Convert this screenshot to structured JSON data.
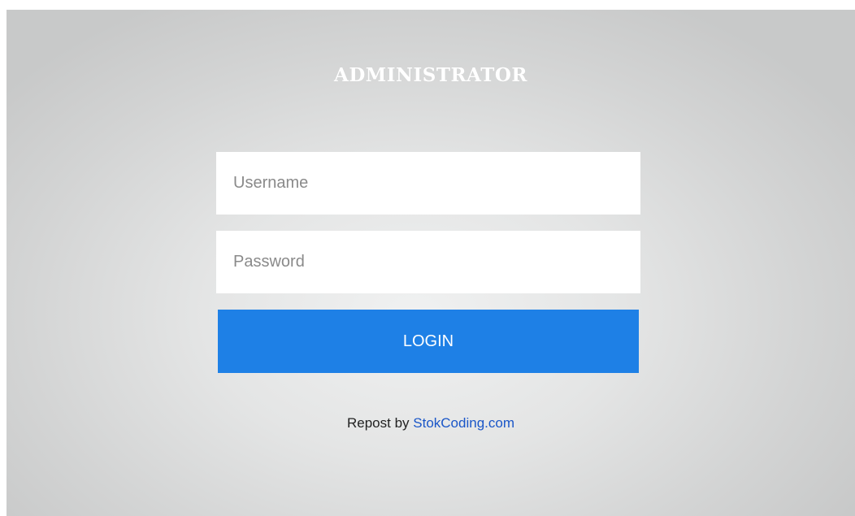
{
  "login": {
    "title": "ADMINISTRATOR",
    "username_placeholder": "Username",
    "password_placeholder": "Password",
    "button_label": "LOGIN"
  },
  "footer": {
    "prefix": "Repost by ",
    "link_text": "StokCoding.com"
  },
  "colors": {
    "button": "#1e80e6",
    "link": "#1a56c8",
    "title": "#ffffff"
  }
}
